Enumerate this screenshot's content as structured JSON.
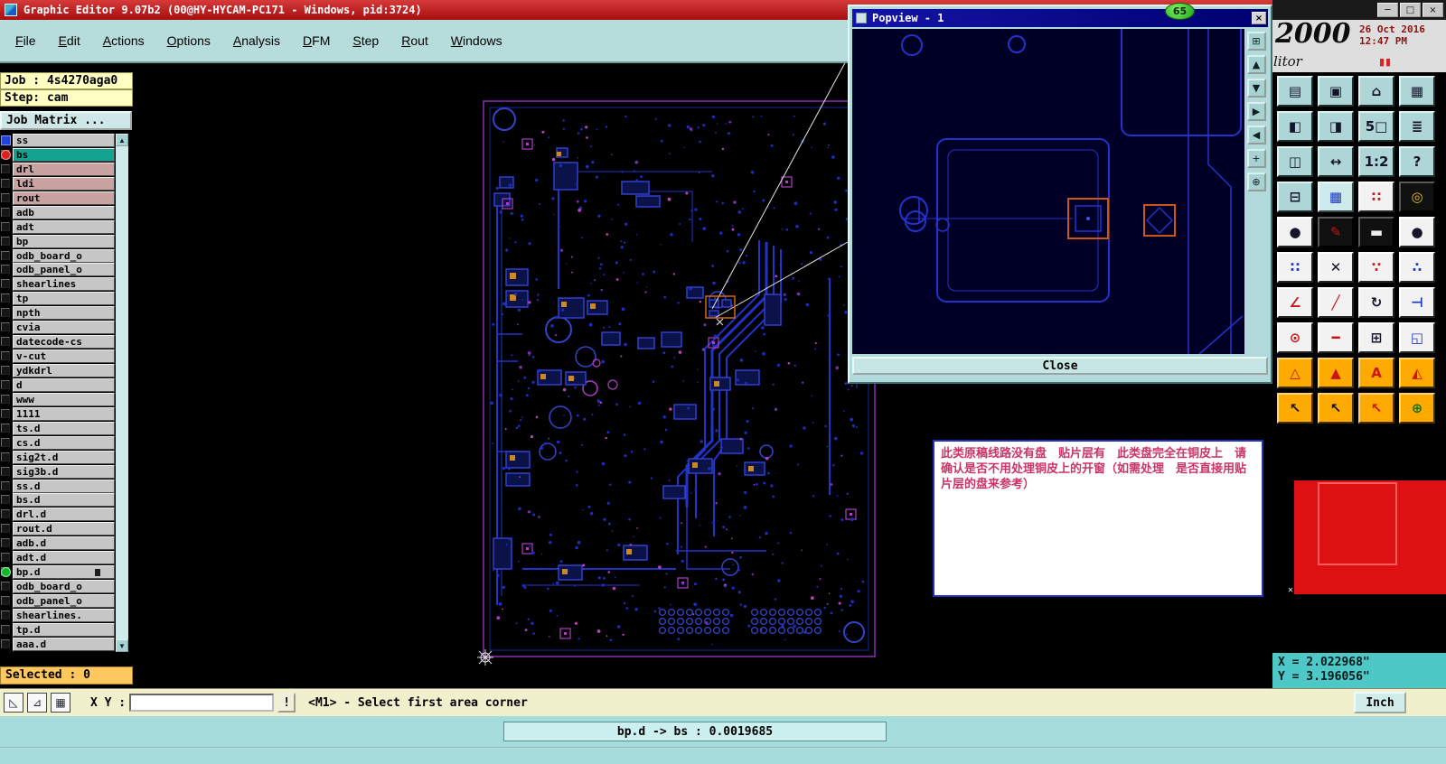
{
  "window": {
    "title": "Graphic Editor 9.07b2 (00@HY-HYCAM-PC171 - Windows, pid:3724)",
    "controls": {
      "minimize": "─",
      "maximize": "□",
      "close": "×"
    }
  },
  "menu": {
    "items": [
      "File",
      "Edit",
      "Actions",
      "Options",
      "Analysis",
      "DFM",
      "Step",
      "Rout",
      "Windows"
    ]
  },
  "sidebar": {
    "job_label": "Job : 4s4270aga0",
    "step_label": "Step: cam",
    "matrix_button": "Job Matrix ...",
    "selected_label": "Selected : 0",
    "layers": [
      {
        "name": "ss",
        "indicator": "blue-square",
        "style": "gray"
      },
      {
        "name": "bs",
        "indicator": "red-circle",
        "style": "active"
      },
      {
        "name": "drl",
        "style": "drill"
      },
      {
        "name": "ldi",
        "style": "drill"
      },
      {
        "name": "rout",
        "style": "drill"
      },
      {
        "name": "adb",
        "style": "gray"
      },
      {
        "name": "adt",
        "style": "gray"
      },
      {
        "name": "bp",
        "style": "gray"
      },
      {
        "name": "odb_board_o",
        "style": "gray"
      },
      {
        "name": "odb_panel_o",
        "style": "gray"
      },
      {
        "name": "shearlines",
        "style": "gray"
      },
      {
        "name": "tp",
        "style": "gray"
      },
      {
        "name": "npth",
        "style": "gray"
      },
      {
        "name": "cvia",
        "style": "gray"
      },
      {
        "name": "datecode-cs",
        "style": "gray"
      },
      {
        "name": "v-cut",
        "style": "gray"
      },
      {
        "name": "ydkdrl",
        "style": "gray"
      },
      {
        "name": "d",
        "style": "gray"
      },
      {
        "name": "www",
        "style": "gray"
      },
      {
        "name": "1111",
        "style": "gray"
      },
      {
        "name": "ts.d",
        "style": "gray"
      },
      {
        "name": "cs.d",
        "style": "gray"
      },
      {
        "name": "sig2t.d",
        "style": "gray"
      },
      {
        "name": "sig3b.d",
        "style": "gray"
      },
      {
        "name": "ss.d",
        "style": "gray"
      },
      {
        "name": "bs.d",
        "style": "gray"
      },
      {
        "name": "drl.d",
        "style": "gray"
      },
      {
        "name": "rout.d",
        "style": "gray"
      },
      {
        "name": "adb.d",
        "style": "gray"
      },
      {
        "name": "adt.d",
        "style": "gray"
      },
      {
        "name": "bp.d",
        "indicator": "green-circle",
        "style": "gray",
        "mark": true
      },
      {
        "name": "odb_board_o",
        "style": "gray"
      },
      {
        "name": "odb_panel_o",
        "style": "gray"
      },
      {
        "name": "shearlines.",
        "style": "gray"
      },
      {
        "name": "tp.d",
        "style": "gray"
      },
      {
        "name": "aaa.d",
        "style": "gray"
      }
    ]
  },
  "popview": {
    "title": "Popview - 1",
    "badge": "65",
    "close_x": "×",
    "close_button": "Close",
    "tools": [
      {
        "name": "popview-window-icon",
        "glyph": "⊞"
      },
      {
        "name": "popview-scroll-up-icon",
        "glyph": "▲"
      },
      {
        "name": "popview-scroll-down-icon",
        "glyph": "▼"
      },
      {
        "name": "popview-scroll-right-icon",
        "glyph": "▶"
      },
      {
        "name": "popview-scroll-left-icon",
        "glyph": "◀"
      },
      {
        "name": "popview-center-icon",
        "glyph": "+"
      },
      {
        "name": "popview-zoom-icon",
        "glyph": "⊕"
      }
    ]
  },
  "clock": {
    "brand": "2000",
    "date": "26 Oct 2016",
    "time": "12:47 PM",
    "logo_text": "litor",
    "pause": "▮▮"
  },
  "right_toolbar": {
    "buttons": [
      {
        "n": "report-icon",
        "g": "▤",
        "c": "t",
        "f": "d"
      },
      {
        "n": "display-icon",
        "g": "▣",
        "c": "t",
        "f": "d"
      },
      {
        "n": "home-view-icon",
        "g": "⌂",
        "c": "t",
        "f": "d"
      },
      {
        "n": "matrix-icon",
        "g": "▦",
        "c": "t",
        "f": "d"
      },
      {
        "n": "pan-left-icon",
        "g": "◧",
        "c": "t",
        "f": "d"
      },
      {
        "n": "pan-right-icon",
        "g": "◨",
        "c": "t",
        "f": "d"
      },
      {
        "n": "zoom-preset-icon",
        "g": "5□",
        "c": "t",
        "f": "d"
      },
      {
        "n": "list-icon",
        "g": "≣",
        "c": "t",
        "f": "d"
      },
      {
        "n": "tile-windows-icon",
        "g": "◫",
        "c": "t",
        "f": "d"
      },
      {
        "n": "pan-icon",
        "g": "↔",
        "c": "t",
        "f": "d"
      },
      {
        "n": "scale-ratio-icon",
        "g": "1:2",
        "c": "t",
        "f": "d"
      },
      {
        "n": "help-icon",
        "g": "?",
        "c": "t",
        "f": "d"
      },
      {
        "n": "netlist-icon",
        "g": "⊟",
        "c": "t",
        "f": "d"
      },
      {
        "n": "grid-icon",
        "g": "▦",
        "c": "lt",
        "f": "b"
      },
      {
        "n": "pad-pattern-icon",
        "g": "∷",
        "c": "w",
        "f": "r"
      },
      {
        "n": "snap-target-icon",
        "g": "◎",
        "c": "k",
        "f": "y"
      },
      {
        "n": "filled-pad-icon",
        "g": "●",
        "c": "w",
        "f": "d"
      },
      {
        "n": "sketch-icon",
        "g": "✎",
        "c": "k",
        "f": "r"
      },
      {
        "n": "line-width-icon",
        "g": "▬",
        "c": "k",
        "f": "w"
      },
      {
        "n": "round-pad-icon",
        "g": "●",
        "c": "w",
        "f": "d"
      },
      {
        "n": "cluster-icon",
        "g": "∷",
        "c": "w",
        "f": "b"
      },
      {
        "n": "delete-icon",
        "g": "✕",
        "c": "w",
        "f": "d"
      },
      {
        "n": "dots-icon",
        "g": "∵",
        "c": "w",
        "f": "r"
      },
      {
        "n": "spread-icon",
        "g": "∴",
        "c": "w",
        "f": "b"
      },
      {
        "n": "angle-line-icon",
        "g": "∠",
        "c": "w",
        "f": "r"
      },
      {
        "n": "diagonal-line-icon",
        "g": "╱",
        "c": "w",
        "f": "r"
      },
      {
        "n": "rotate-icon",
        "g": "↻",
        "c": "w",
        "f": "d"
      },
      {
        "n": "mirror-icon",
        "g": "⊣",
        "c": "w",
        "f": "b"
      },
      {
        "n": "small-target-icon",
        "g": "⊙",
        "c": "w",
        "f": "r"
      },
      {
        "n": "red-dash-icon",
        "g": "━",
        "c": "w",
        "f": "r"
      },
      {
        "n": "register-icon",
        "g": "⊞",
        "c": "w",
        "f": "d"
      },
      {
        "n": "copy-layer-icon",
        "g": "◱",
        "c": "w",
        "f": "b"
      },
      {
        "n": "triangle-outline-icon",
        "g": "△",
        "c": "o",
        "f": "r"
      },
      {
        "n": "triangle-filled-icon",
        "g": "▲",
        "c": "o",
        "f": "r"
      },
      {
        "n": "letter-a-icon",
        "g": "A",
        "c": "o",
        "f": "r"
      },
      {
        "n": "triangle-half-icon",
        "g": "◭",
        "c": "o",
        "f": "r"
      },
      {
        "n": "select-cursor-icon",
        "g": "↖",
        "c": "o",
        "f": "d"
      },
      {
        "n": "select-cursor-dot-icon",
        "g": "↖",
        "c": "o",
        "f": "d"
      },
      {
        "n": "select-cursor-red-icon",
        "g": "↖",
        "c": "o",
        "f": "r"
      },
      {
        "n": "pick-tool-icon",
        "g": "⊕",
        "c": "o",
        "f": "g"
      }
    ]
  },
  "note": {
    "text": "此类原稿线路没有盘　贴片层有　此类盘完全在铜皮上　请确认是否不用处理铜皮上的开窗（如需处理　是否直接用贴片层的盘来参考）"
  },
  "coords": {
    "x": "X = 2.022968\"",
    "y": "Y = 3.196056\""
  },
  "bottom_bar": {
    "xy_label": "X Y :",
    "input_value": "",
    "alert": "!",
    "prompt": "<M1> - Select first area corner",
    "units_button": "Inch",
    "tools": [
      {
        "name": "draw-line-icon",
        "glyph": "◺"
      },
      {
        "name": "measure-angle-icon",
        "glyph": "⊿"
      },
      {
        "name": "grid-toggle-icon",
        "glyph": "▦"
      }
    ]
  },
  "status_bar": {
    "text": "bp.d -> bs : 0.0019685"
  },
  "colors": {
    "titlebar_red": "#c41414",
    "menubar_teal": "#b6dcdc",
    "active_layer_teal": "#14a390",
    "drill_layer_pink": "#c9a2a2",
    "selected_amber": "#ffc85e",
    "note_text_red": "#cc3366",
    "preview_red": "#dd1111",
    "toolbar_orange": "#ffaa00",
    "pcb_trace_blue": "#2233cc",
    "board_outline_purple": "#8c2fb4"
  }
}
